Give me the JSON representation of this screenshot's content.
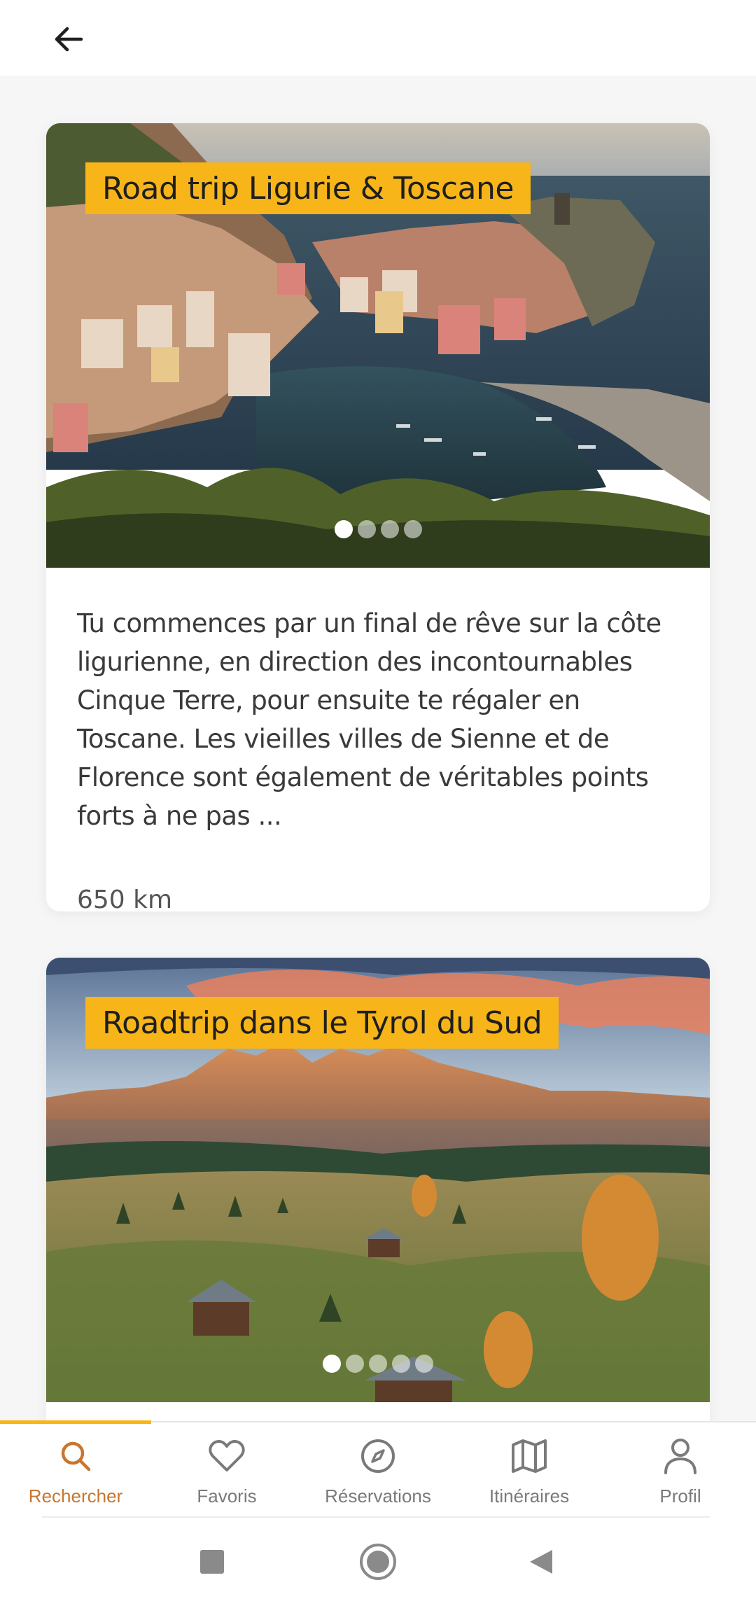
{
  "header": {
    "back_icon": "arrow-left-icon"
  },
  "cards": [
    {
      "title": "Road trip Ligurie & Toscane",
      "description": "Tu commences par un final de rêve sur la côte ligurienne, en direction des incontournables Cinque Terre, pour ensuite te régaler en Toscane. Les vieilles villes de Sienne et de Florence sont également de véritables points forts à ne pas ...",
      "distance": "650 km",
      "carousel": {
        "total": 4,
        "active": 1
      }
    },
    {
      "title": "Roadtrip dans le Tyrol du Sud",
      "carousel": {
        "total": 5,
        "active": 1
      }
    }
  ],
  "bottom_nav": {
    "items": [
      {
        "label": "Rechercher",
        "icon": "search-icon",
        "active": true
      },
      {
        "label": "Favoris",
        "icon": "heart-icon",
        "active": false
      },
      {
        "label": "Réservations",
        "icon": "compass-icon",
        "active": false
      },
      {
        "label": "Itinéraires",
        "icon": "map-icon",
        "active": false
      },
      {
        "label": "Profil",
        "icon": "user-icon",
        "active": false
      }
    ]
  },
  "system_nav": {
    "icons": [
      "recents-icon",
      "home-icon",
      "back-triangle-icon"
    ]
  },
  "colors": {
    "accent": "#f7b519",
    "active_label": "#c9752d",
    "inactive": "#7a7a7a"
  }
}
